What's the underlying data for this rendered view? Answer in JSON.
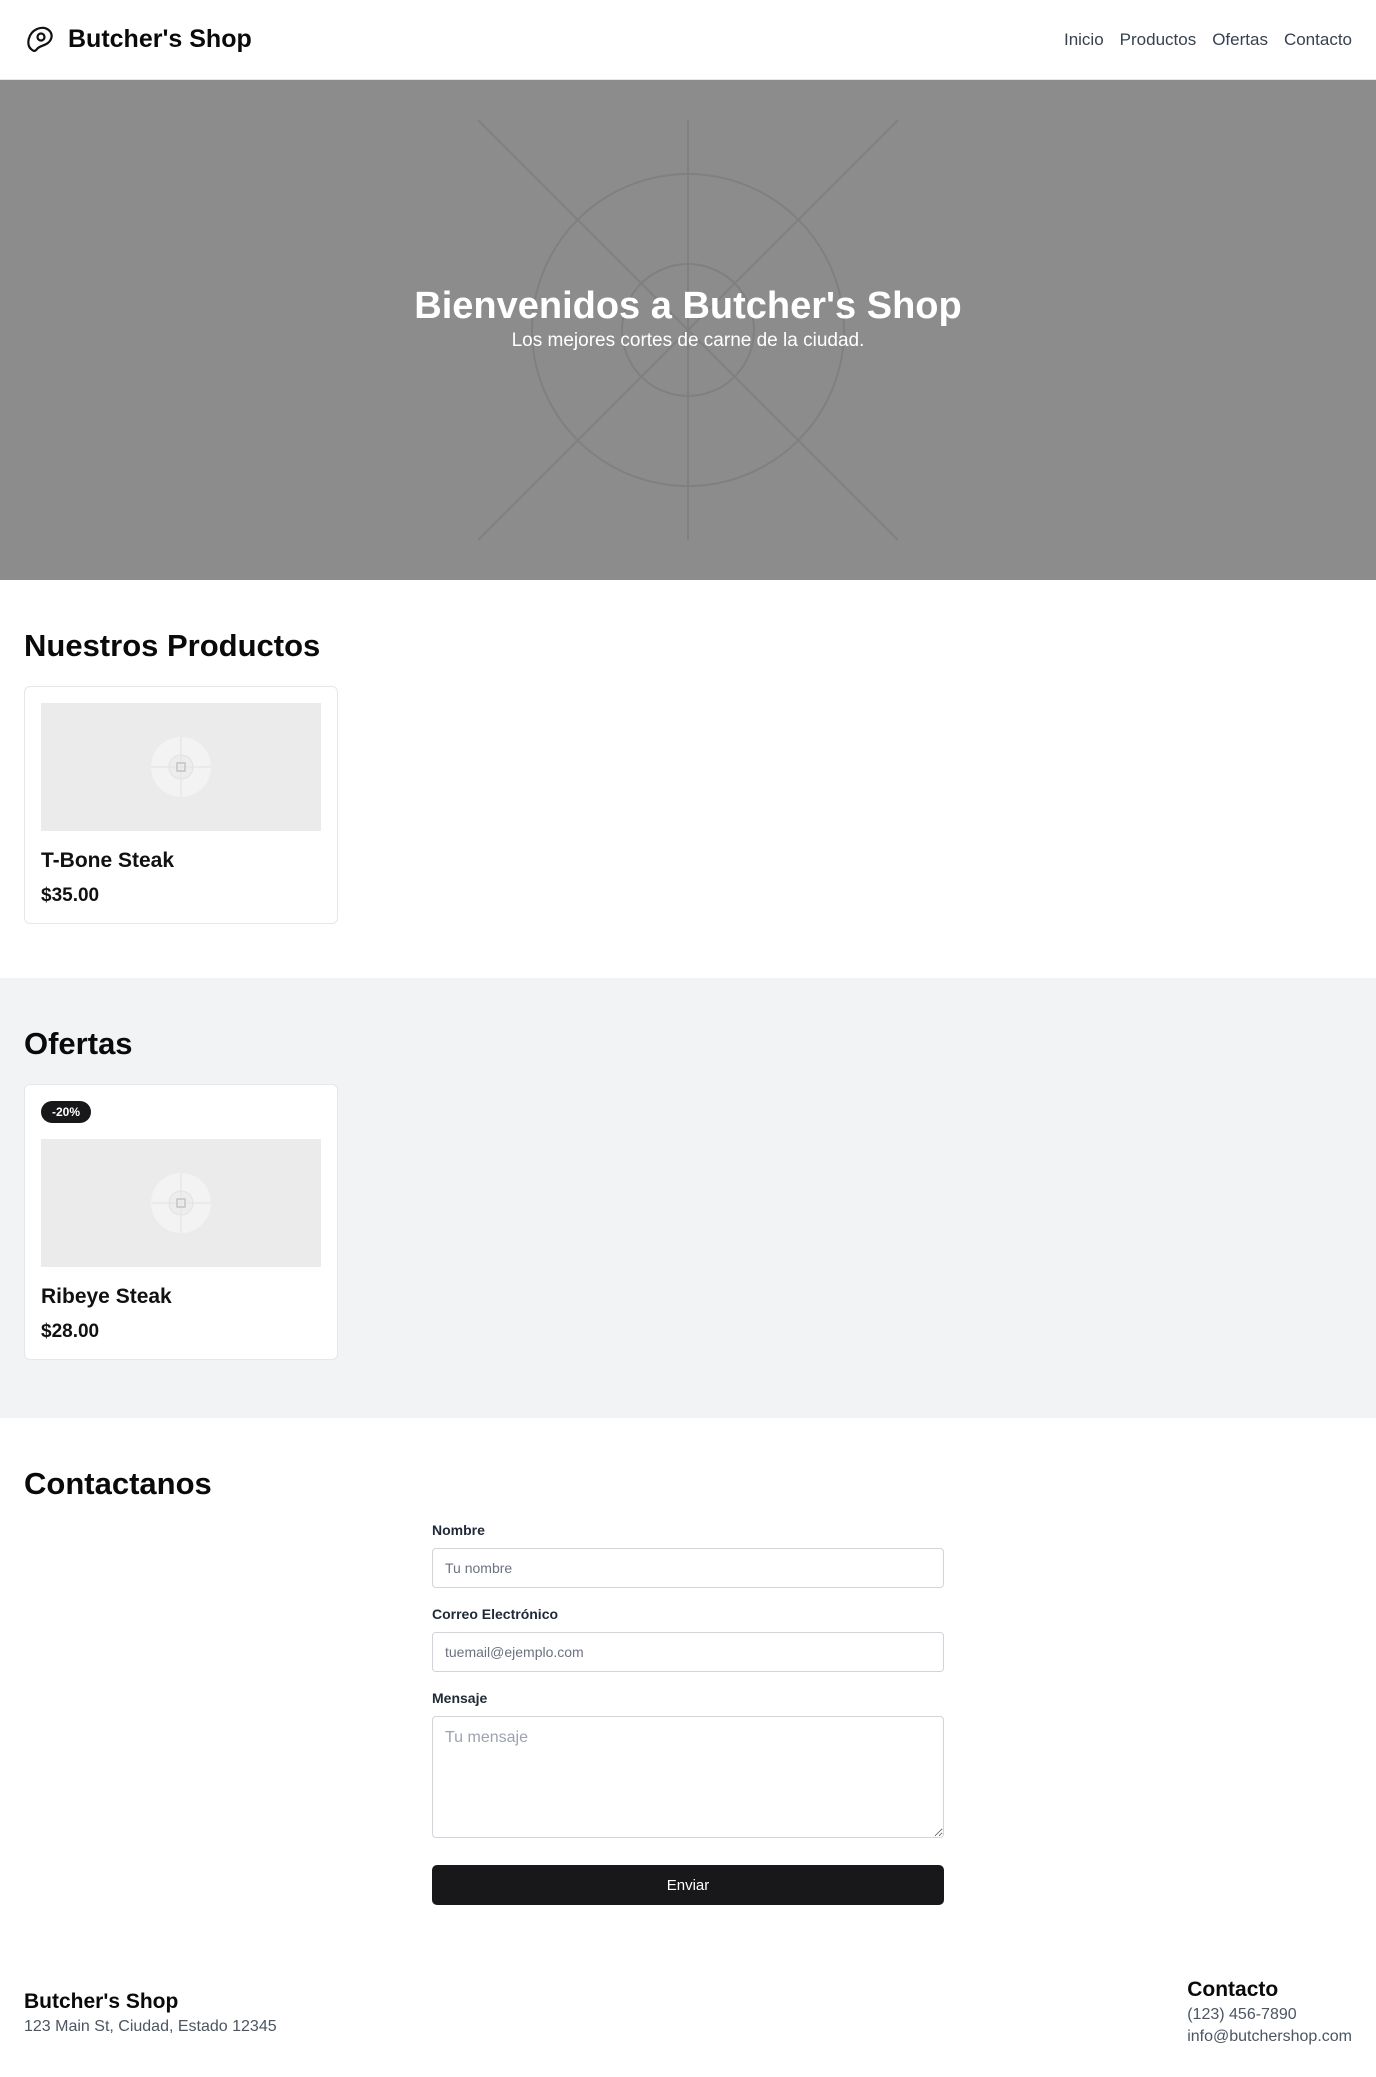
{
  "header": {
    "brand": "Butcher's Shop",
    "nav": [
      "Inicio",
      "Productos",
      "Ofertas",
      "Contacto"
    ]
  },
  "hero": {
    "title": "Bienvenidos a Butcher's Shop",
    "subtitle": "Los mejores cortes de carne de la ciudad."
  },
  "products": {
    "title": "Nuestros Productos",
    "items": [
      {
        "name": "T-Bone Steak",
        "price": "$35.00",
        "icon": "image-placeholder-icon"
      }
    ]
  },
  "offers": {
    "title": "Ofertas",
    "items": [
      {
        "badge": "-20%",
        "name": "Ribeye Steak",
        "price": "$28.00",
        "icon": "image-placeholder-icon"
      }
    ]
  },
  "contact": {
    "title": "Contactanos",
    "name_label": "Nombre",
    "name_placeholder": "Tu nombre",
    "email_label": "Correo Electrónico",
    "email_placeholder": "tuemail@ejemplo.com",
    "message_label": "Mensaje",
    "message_placeholder": "Tu mensaje",
    "submit_label": "Enviar"
  },
  "footer": {
    "brand": "Butcher's Shop",
    "address": "123 Main St, Ciudad, Estado 12345",
    "contact_title": "Contacto",
    "phone": "(123) 456-7890",
    "email": "info@butchershop.com"
  },
  "colors": {
    "hero_bg": "#8c8c8c",
    "offers_bg": "#f2f3f5",
    "button_bg": "#18181b"
  }
}
